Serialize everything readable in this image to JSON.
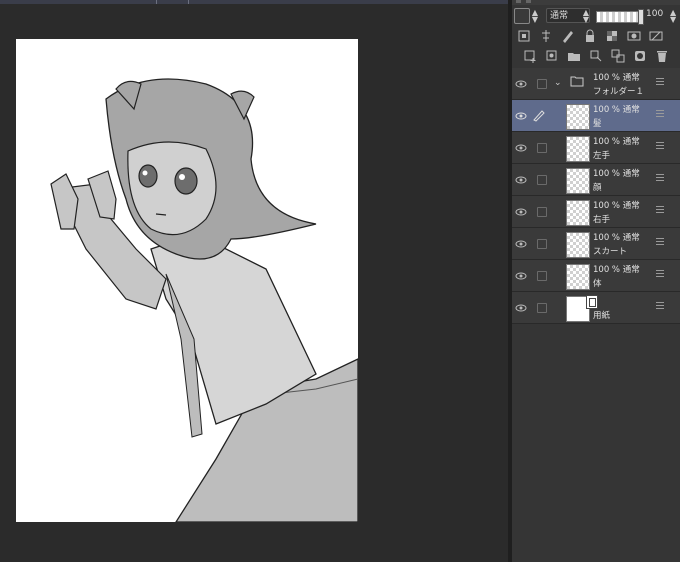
{
  "panel": {
    "blend_mode": "通常",
    "opacity": "100",
    "layers": [
      {
        "sub": "100 % 通常",
        "name": "フォルダー１",
        "type": "folder"
      },
      {
        "sub": "100 % 通常",
        "name": "髪",
        "type": "raster",
        "selected": true
      },
      {
        "sub": "100 % 通常",
        "name": "左手",
        "type": "raster"
      },
      {
        "sub": "100 % 通常",
        "name": "顔",
        "type": "raster"
      },
      {
        "sub": "100 % 通常",
        "name": "右手",
        "type": "raster"
      },
      {
        "sub": "100 % 通常",
        "name": "スカート",
        "type": "raster"
      },
      {
        "sub": "100 % 通常",
        "name": "体",
        "type": "raster"
      },
      {
        "sub": "",
        "name": "用紙",
        "type": "paper"
      }
    ]
  },
  "canvas": {
    "artwork": "grayscale manga girl illustration"
  },
  "colors": {
    "panel_bg": "#353535",
    "selected_layer": "#5f6b8c",
    "canvas_bg": "#2b2b2b"
  }
}
